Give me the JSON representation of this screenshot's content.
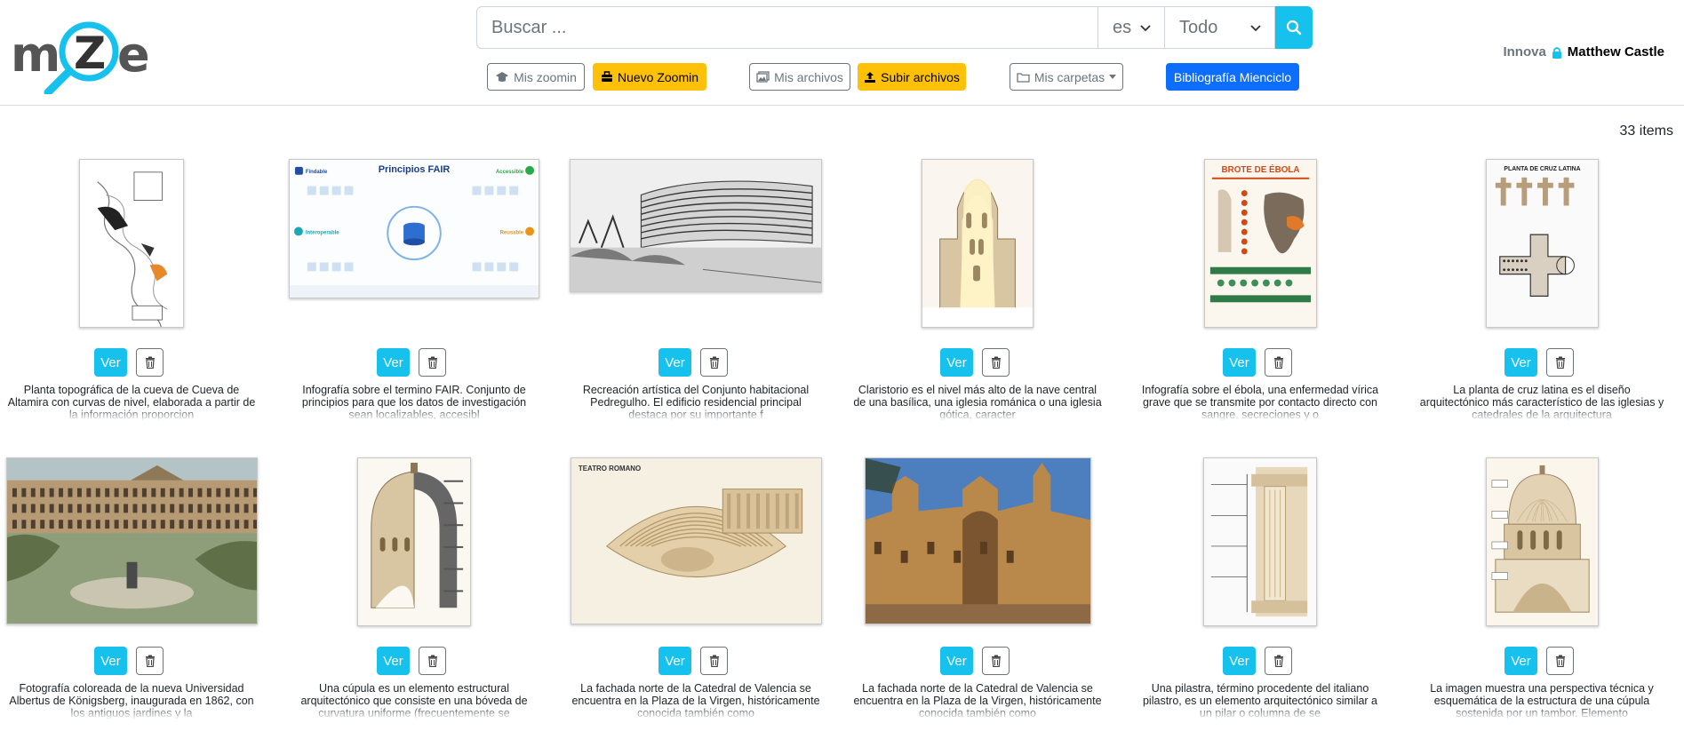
{
  "app": {
    "logo_text": "mZe"
  },
  "search": {
    "placeholder": "Buscar ...",
    "value": ""
  },
  "language_select": {
    "selected": "es"
  },
  "scope_select": {
    "selected": "Todo"
  },
  "toolbar": {
    "mis_zoomin": "Mis zoomin",
    "nuevo_zoomin": "Nuevo Zoomin",
    "mis_archivos": "Mis archivos",
    "subir_archivos": "Subir archivos",
    "mis_carpetas": "Mis carpetas",
    "bibliografia": "Bibliografía Mienciclo"
  },
  "user": {
    "org": "Innova",
    "name": "Matthew Castle"
  },
  "items_count": "33 items",
  "colors": {
    "accent": "#17c1ee",
    "warning": "#ffc107",
    "primary": "#0d6efd"
  },
  "card_labels": {
    "ver": "Ver"
  },
  "items": [
    {
      "kind": "cave-map",
      "description": "Planta topográfica de la cueva de Cueva de Altamira con curvas de nivel, elaborada a partir de la información proporcion"
    },
    {
      "kind": "fair-infographic",
      "description": "Infografía sobre el termino FAIR. Conjunto de principios para que los datos de investigación sean localizables, accesibl"
    },
    {
      "kind": "building-sketch",
      "description": "Recreación artística del Conjunto habitacional Pedregulho. El edificio residencial principal destaca por su importante f"
    },
    {
      "kind": "clerestory",
      "description": "Claristorio es el nivel más alto de la nave central de una basílica, una iglesia románica o una iglesia gótica, caracter"
    },
    {
      "kind": "ebola-infographic",
      "description": "Infografía sobre el ébola, una enfermedad vírica grave que se transmite por contacto directo con sangre, secreciones y o"
    },
    {
      "kind": "latin-cross",
      "description": "La planta de cruz latina es el diseño arquitectónico más característico de las iglesias y catedrales de la arquitectura"
    },
    {
      "kind": "university-photo",
      "description": "Fotografía coloreada de la nueva Universidad Albertus de Königsberg, inaugurada en 1862, con los antiguos jardines y la"
    },
    {
      "kind": "dome-section",
      "description": "Una cúpula es un elemento estructural arquitectónico que consiste en una bóveda de curvatura uniforme (frecuentemente se"
    },
    {
      "kind": "roman-theater",
      "description": "La fachada norte de la Catedral de Valencia se encuentra en la Plaza de la Virgen, históricamente conocida también como"
    },
    {
      "kind": "cathedral-photo",
      "description": "La fachada norte de la Catedral de Valencia se encuentra en la Plaza de la Virgen, históricamente conocida también como"
    },
    {
      "kind": "pilaster",
      "description": "Una pilastra, término procedente del italiano pilastro, es un elemento arquitectónico similar a un pilar o columna de se"
    },
    {
      "kind": "dome-drum",
      "description": "La imagen muestra una perspectiva técnica y esquemática de la estructura de una cúpula sostenida por un tambor. Elemento"
    }
  ],
  "thumb_text": {
    "fair_title": "Principios FAIR",
    "fair_f": "Findable",
    "fair_a": "Accessible",
    "fair_i": "Interoperable",
    "fair_r": "Reusable",
    "ebola_title": "BROTE DE ÉBOLA",
    "cruz_title": "PLANTA DE CRUZ LATINA",
    "teatro_title": "TEATRO ROMANO"
  }
}
